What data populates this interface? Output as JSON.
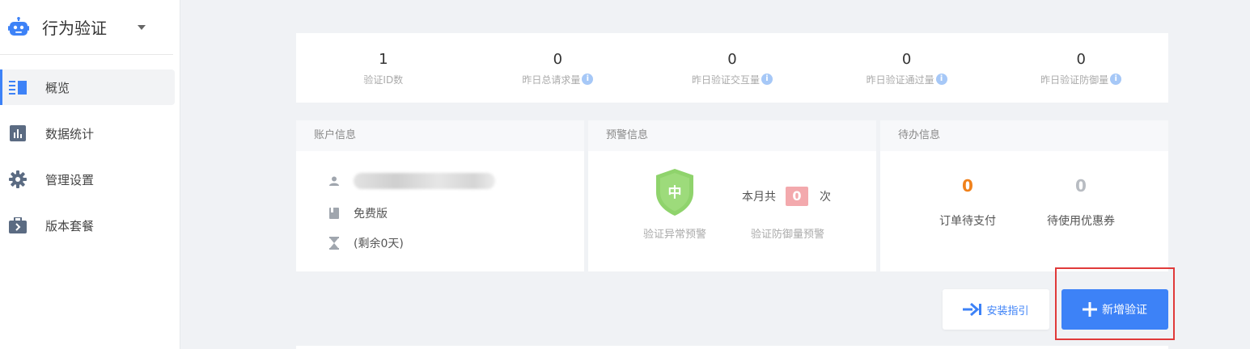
{
  "app": {
    "title": "行为验证"
  },
  "sidebar": {
    "items": [
      {
        "label": "概览",
        "icon": "overview-icon",
        "active": true
      },
      {
        "label": "数据统计",
        "icon": "bar-chart-icon",
        "active": false
      },
      {
        "label": "管理设置",
        "icon": "gear-icon",
        "active": false
      },
      {
        "label": "版本套餐",
        "icon": "briefcase-icon",
        "active": false
      }
    ]
  },
  "stats": [
    {
      "value": "1",
      "label": "验证ID数",
      "info": false
    },
    {
      "value": "0",
      "label": "昨日总请求量",
      "info": true
    },
    {
      "value": "0",
      "label": "昨日验证交互量",
      "info": true
    },
    {
      "value": "0",
      "label": "昨日验证通过量",
      "info": true
    },
    {
      "value": "0",
      "label": "昨日验证防御量",
      "info": true
    }
  ],
  "account": {
    "header": "账户信息",
    "plan": "免费版",
    "remaining": "(剩余0天)"
  },
  "warning": {
    "header": "预警信息",
    "shield_text": "中",
    "abnormal_label": "验证异常预警",
    "month_prefix": "本月共",
    "month_count": "0",
    "month_suffix": "次",
    "defense_label": "验证防御量预警"
  },
  "todo": {
    "header": "待办信息",
    "orders_count": "0",
    "orders_label": "订单待支付",
    "coupons_count": "0",
    "coupons_label": "待使用优惠券"
  },
  "buttons": {
    "guide": "安装指引",
    "add": "新增验证"
  },
  "colors": {
    "accent": "#3d82f7",
    "orange": "#f0811b",
    "shield_green": "#8fd36c",
    "highlight_red": "#e03a3a"
  }
}
